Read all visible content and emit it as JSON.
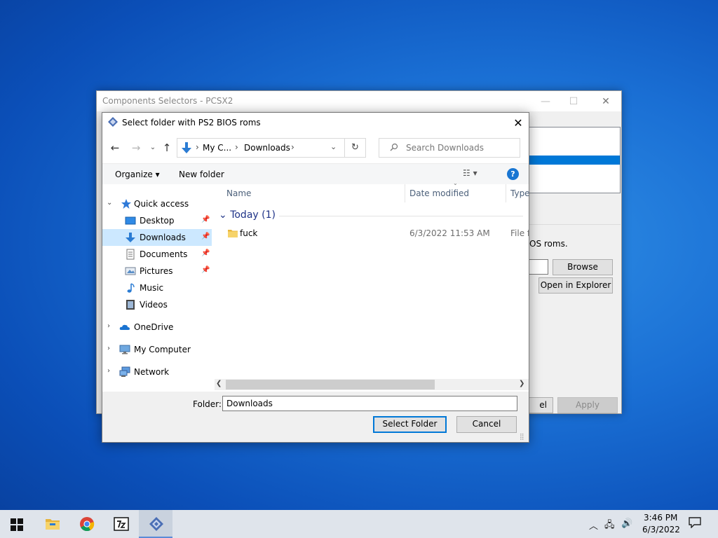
{
  "background_window": {
    "title": "Components Selectors - PCSX2",
    "minimize": "—",
    "maximize": "☐",
    "close": "✕",
    "bios_description_fragment": "OS roms.",
    "browse_label": "Browse",
    "open_explorer_label": "Open in Explorer",
    "cancel_fragment": "el",
    "apply_label": "Apply"
  },
  "dialog": {
    "title": "Select folder with PS2 BIOS roms",
    "close": "✕",
    "nav": {
      "back": "←",
      "forward": "→",
      "recent": "⌄",
      "up": "↑"
    },
    "address": {
      "crumbs": [
        "My C...",
        "Downloads"
      ],
      "separator": "›",
      "dropdown": "⌄",
      "refresh": "↻"
    },
    "search": {
      "placeholder": "Search Downloads"
    },
    "toolbar": {
      "organize_label": "Organize ▾",
      "new_folder_label": "New folder",
      "view_label": "☷ ▾",
      "help_label": "?"
    },
    "sidebar": {
      "items": [
        {
          "label": "Quick access"
        },
        {
          "label": "Desktop"
        },
        {
          "label": "Downloads"
        },
        {
          "label": "Documents"
        },
        {
          "label": "Pictures"
        },
        {
          "label": "Music"
        },
        {
          "label": "Videos"
        },
        {
          "label": "OneDrive"
        },
        {
          "label": "My Computer"
        },
        {
          "label": "Network"
        }
      ],
      "expand_glyph": "›",
      "collapse_glyph": "⌄",
      "pin_glyph": "📌"
    },
    "columns": {
      "name": "Name",
      "date_modified": "Date modified",
      "type": "Type"
    },
    "group": {
      "label": "Today (1)",
      "chevron": "⌄"
    },
    "files": [
      {
        "name": "fuck",
        "date_modified": "6/3/2022 11:53 AM",
        "type": "File folder"
      }
    ],
    "scroll": {
      "left": "❮",
      "right": "❯"
    },
    "footer": {
      "folder_label": "Folder:",
      "folder_value": "Downloads",
      "select_folder_label": "Select Folder",
      "cancel_label": "Cancel",
      "grip": "⣿"
    }
  },
  "taskbar": {
    "tray": {
      "chevron": "︿",
      "network": "🖧",
      "volume": "🔊"
    },
    "time": "3:46 PM",
    "date": "6/3/2022"
  },
  "colors": {
    "accent": "#0078d7",
    "selection": "#cce8ff",
    "folder": "#f3c94a",
    "desktop": "#1a6fd4"
  }
}
